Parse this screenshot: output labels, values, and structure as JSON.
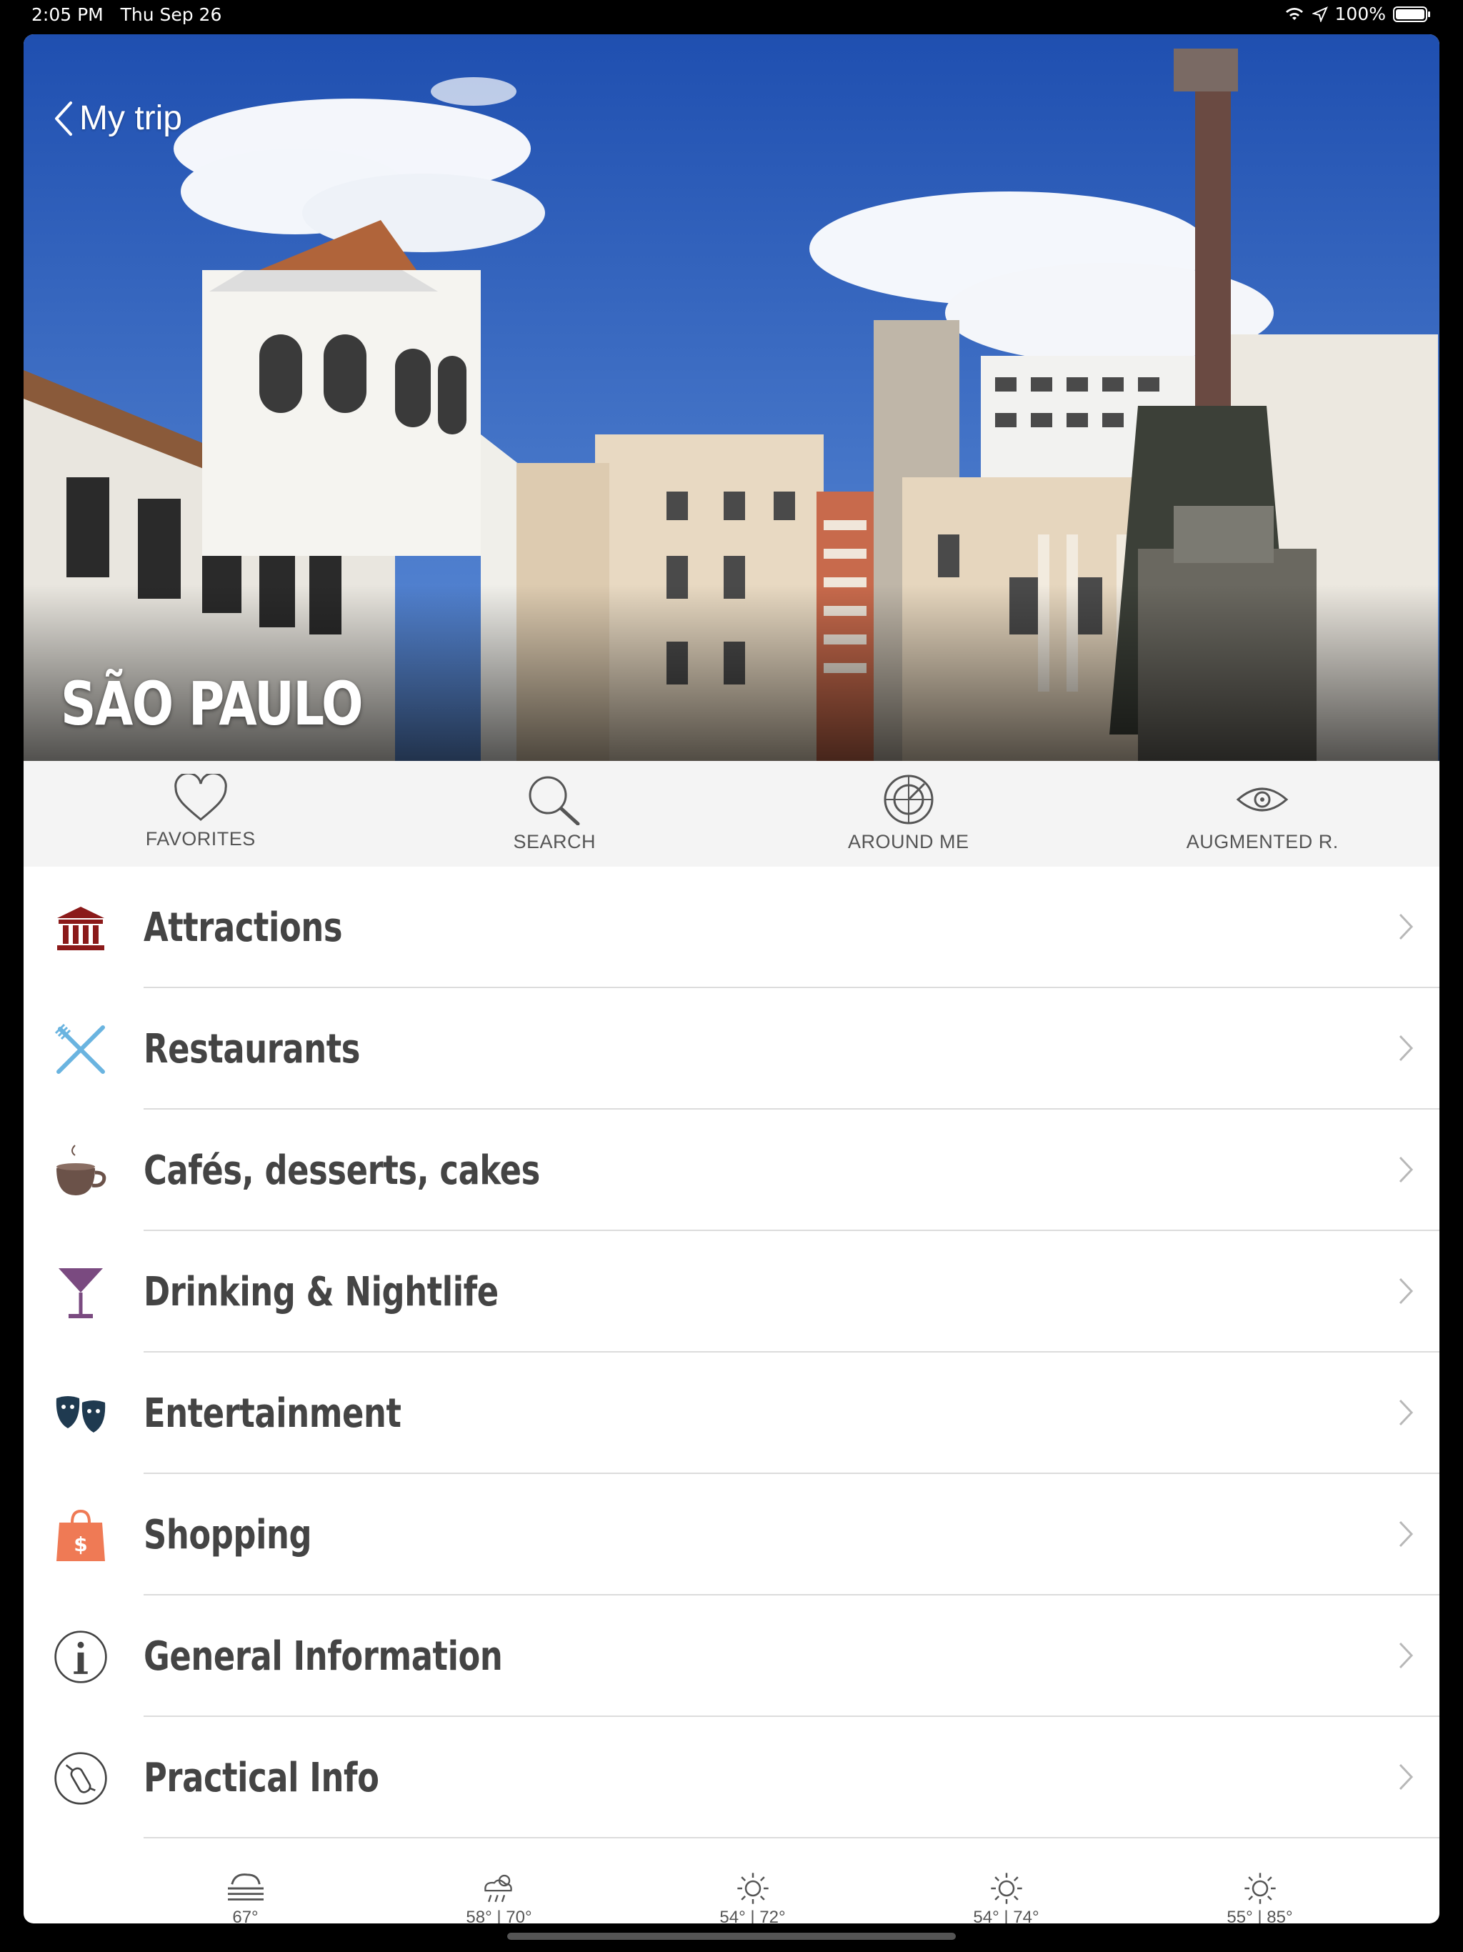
{
  "status_bar": {
    "time": "2:05 PM",
    "date": "Thu Sep 26",
    "battery": "100%"
  },
  "nav": {
    "back_label": "My trip"
  },
  "hero": {
    "title": "SÃO PAULO"
  },
  "toolbar": [
    {
      "label": "FAVORITES",
      "icon": "heart-icon"
    },
    {
      "label": "SEARCH",
      "icon": "search-icon"
    },
    {
      "label": "AROUND ME",
      "icon": "radar-icon"
    },
    {
      "label": "AUGMENTED R.",
      "icon": "eye-icon"
    }
  ],
  "menu": [
    {
      "label": "Attractions",
      "icon": "museum-icon",
      "color": "#8b1a1a"
    },
    {
      "label": "Restaurants",
      "icon": "fork-knife-icon",
      "color": "#6ab4e0"
    },
    {
      "label": "Cafés, desserts, cakes",
      "icon": "coffee-cup-icon",
      "color": "#6b5249"
    },
    {
      "label": "Drinking & Nightlife",
      "icon": "cocktail-icon",
      "color": "#7a4a80"
    },
    {
      "label": "Entertainment",
      "icon": "theater-masks-icon",
      "color": "#1f3a50"
    },
    {
      "label": "Shopping",
      "icon": "shopping-bag-icon",
      "color": "#ef7a55"
    },
    {
      "label": "General Information",
      "icon": "info-icon",
      "color": "#444444"
    },
    {
      "label": "Practical Info",
      "icon": "swiss-knife-icon",
      "color": "#444444"
    }
  ],
  "weather": [
    {
      "icon": "fog-icon",
      "temp": "67°"
    },
    {
      "icon": "rain-sun-icon",
      "temp": "58° | 70°"
    },
    {
      "icon": "sun-icon",
      "temp": "54° | 72°"
    },
    {
      "icon": "sun-icon",
      "temp": "54° | 74°"
    },
    {
      "icon": "sun-icon",
      "temp": "55° | 85°"
    }
  ]
}
